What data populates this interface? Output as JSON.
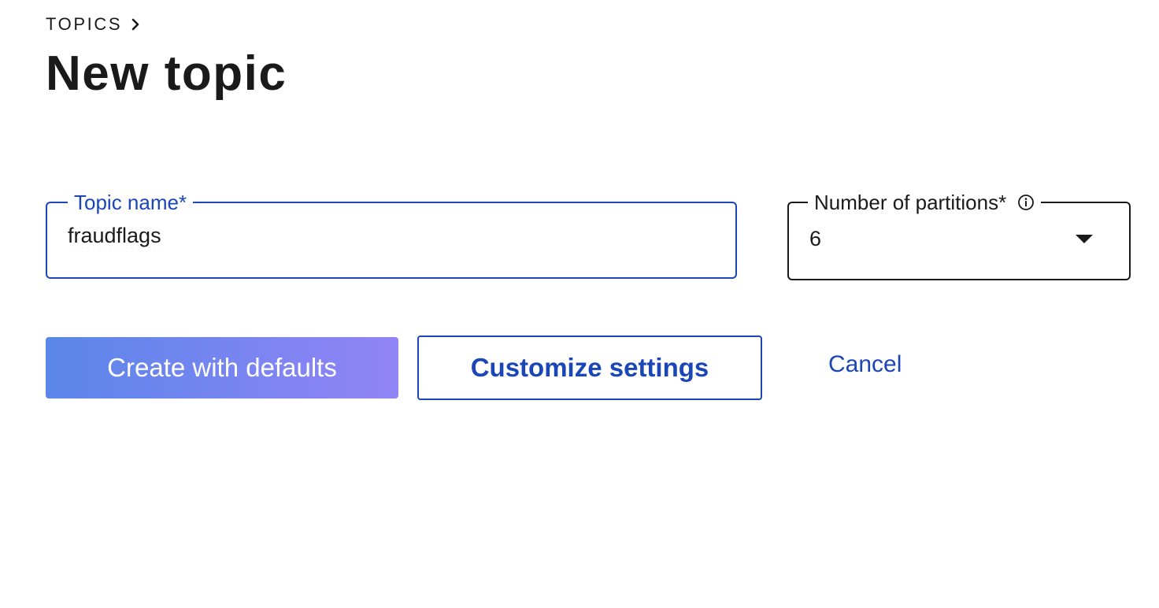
{
  "breadcrumb": {
    "parent_label": "TOPICS"
  },
  "page": {
    "title": "New topic"
  },
  "form": {
    "topic_name": {
      "label": "Topic name*",
      "value": "fraudflags"
    },
    "partitions": {
      "label": "Number of partitions*",
      "selected_value": "6",
      "info_icon": "info-icon"
    }
  },
  "actions": {
    "create_defaults_label": "Create with defaults",
    "customize_label": "Customize settings",
    "cancel_label": "Cancel"
  },
  "colors": {
    "accent": "#1b46b8",
    "primary_gradient_start": "#5a86ea",
    "primary_gradient_end": "#9284f6",
    "text": "#1a1a1a"
  }
}
